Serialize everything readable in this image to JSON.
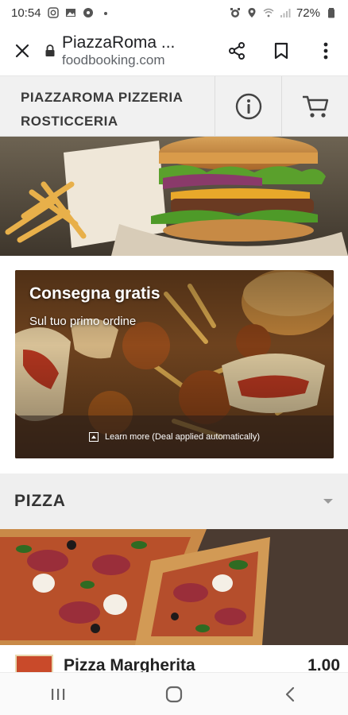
{
  "status_bar": {
    "time": "10:54",
    "left_icons": [
      "instagram-icon",
      "gallery-icon",
      "chat-icon",
      "dot-icon"
    ],
    "right_icons": [
      "alarm-icon",
      "location-icon",
      "wifi-icon",
      "signal-icon",
      "battery-icon"
    ],
    "battery": "72%"
  },
  "browser": {
    "close_icon": "close-icon",
    "site_title": "PiazzaRoma ...",
    "domain": "foodbooking.com",
    "actions": [
      "share-icon",
      "bookmark-icon",
      "more-vertical-icon"
    ]
  },
  "restaurant": {
    "name_line1": "PIAZZAROMA PIZZERIA",
    "name_line2": "ROSTICCERIA",
    "info_icon": "info-icon",
    "cart_icon": "cart-icon"
  },
  "promo": {
    "title": "Consegna gratis",
    "subtitle": "Sul tuo primo ordine",
    "learn_more": "Learn more (Deal applied automatically)"
  },
  "category": {
    "title": "PIZZA",
    "caret_icon": "chevron-down-icon"
  },
  "menu_items": [
    {
      "name": "Pizza Margherita",
      "price": "1.00"
    }
  ],
  "nav": {
    "buttons": [
      "recents-icon",
      "home-icon",
      "back-icon"
    ]
  },
  "colors": {
    "header_bg": "#f1f1f1",
    "category_bg": "#efefef",
    "text_dark": "#222222"
  }
}
